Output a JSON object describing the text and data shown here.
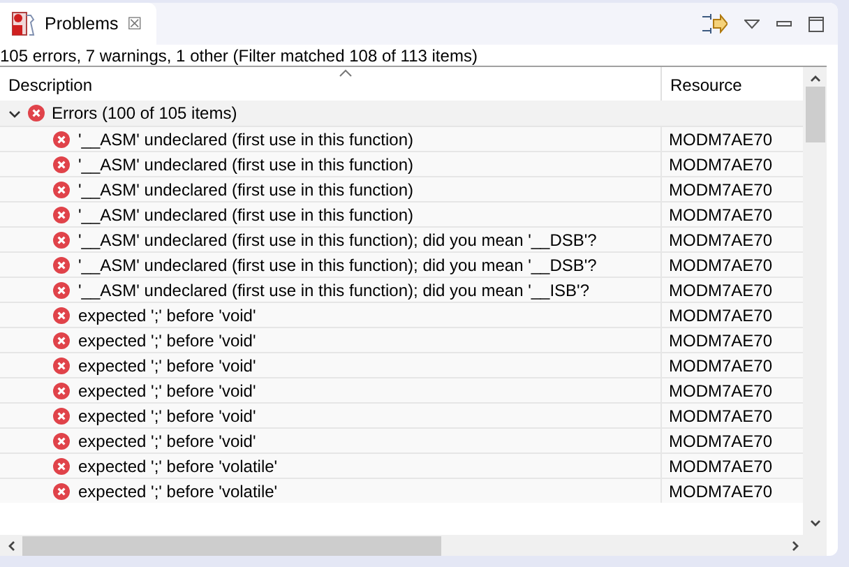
{
  "tab": {
    "title": "Problems",
    "close": "☒"
  },
  "summary": "105 errors, 7 warnings, 1 other (Filter matched 108 of 113 items)",
  "table": {
    "columns": [
      {
        "label": "Description",
        "sorted": true
      },
      {
        "label": "Resource",
        "sorted": false
      }
    ],
    "group": {
      "label": "Errors (100 of 105 items)",
      "expanded": true
    },
    "rows": [
      {
        "description": "'__ASM' undeclared (first use in this function)",
        "resource": "MODM7AE70"
      },
      {
        "description": "'__ASM' undeclared (first use in this function)",
        "resource": "MODM7AE70"
      },
      {
        "description": "'__ASM' undeclared (first use in this function)",
        "resource": "MODM7AE70"
      },
      {
        "description": "'__ASM' undeclared (first use in this function)",
        "resource": "MODM7AE70"
      },
      {
        "description": "'__ASM' undeclared (first use in this function); did you mean '__DSB'?",
        "resource": "MODM7AE70"
      },
      {
        "description": "'__ASM' undeclared (first use in this function); did you mean '__DSB'?",
        "resource": "MODM7AE70"
      },
      {
        "description": "'__ASM' undeclared (first use in this function); did you mean '__ISB'?",
        "resource": "MODM7AE70"
      },
      {
        "description": "expected ';' before 'void'",
        "resource": "MODM7AE70"
      },
      {
        "description": "expected ';' before 'void'",
        "resource": "MODM7AE70"
      },
      {
        "description": "expected ';' before 'void'",
        "resource": "MODM7AE70"
      },
      {
        "description": "expected ';' before 'void'",
        "resource": "MODM7AE70"
      },
      {
        "description": "expected ';' before 'void'",
        "resource": "MODM7AE70"
      },
      {
        "description": "expected ';' before 'void'",
        "resource": "MODM7AE70"
      },
      {
        "description": "expected ';' before 'volatile'",
        "resource": "MODM7AE70"
      },
      {
        "description": "expected ';' before 'volatile'",
        "resource": "MODM7AE70"
      }
    ]
  }
}
